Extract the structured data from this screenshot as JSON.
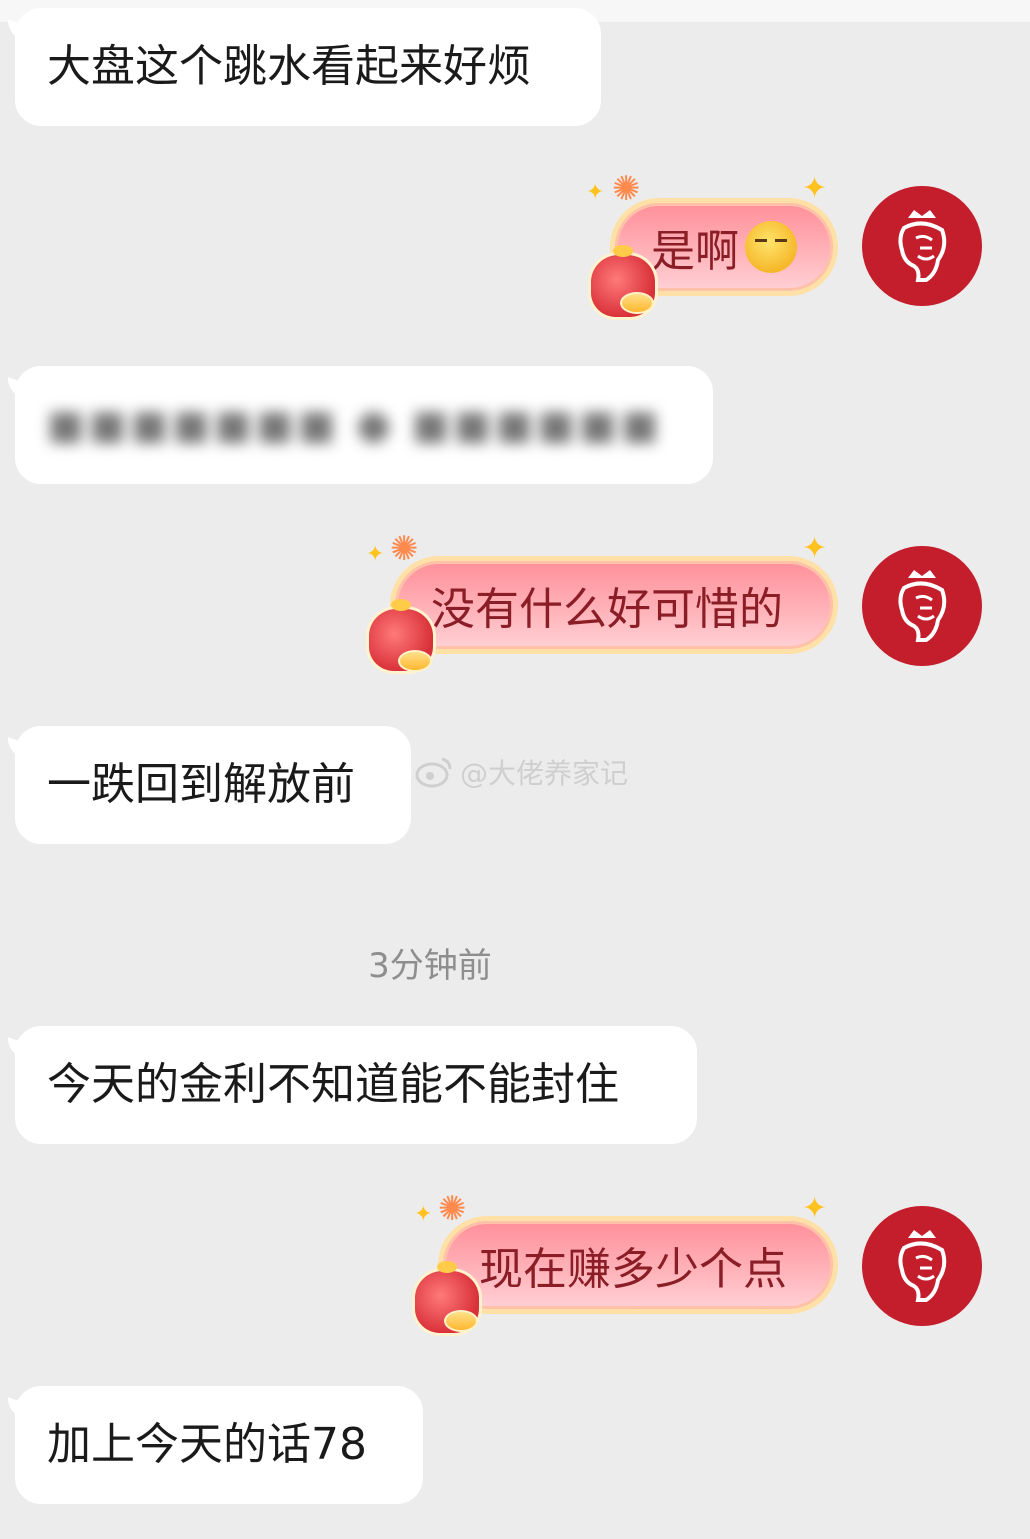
{
  "messages": [
    {
      "id": "m1",
      "side": "incoming",
      "text": "大盘这个跳水看起来好烦"
    },
    {
      "id": "m2",
      "side": "outgoing",
      "text": "是啊",
      "emoji": "thinking-face"
    },
    {
      "id": "m3",
      "side": "incoming",
      "text": "",
      "blurred": true
    },
    {
      "id": "m4",
      "side": "outgoing",
      "text": "没有什么好可惜的"
    },
    {
      "id": "m5",
      "side": "incoming",
      "text": "一跌回到解放前"
    },
    {
      "id": "m6",
      "side": "incoming",
      "text": "今天的金利不知道能不能封住"
    },
    {
      "id": "m7",
      "side": "outgoing",
      "text": "现在赚多少个点"
    },
    {
      "id": "m8",
      "side": "incoming",
      "text": "加上今天的话78"
    }
  ],
  "timestamp": "3分钟前",
  "watermark": {
    "text": "@大佬养家记",
    "icon": "weibo-icon"
  },
  "avatar": {
    "icon": "lion-crest-icon",
    "color": "#c41e2d"
  },
  "colors": {
    "background": "#ececec",
    "incoming_bubble": "#ffffff",
    "outgoing_bubble": "#ffa3ab",
    "outgoing_text": "#8a1d25"
  }
}
